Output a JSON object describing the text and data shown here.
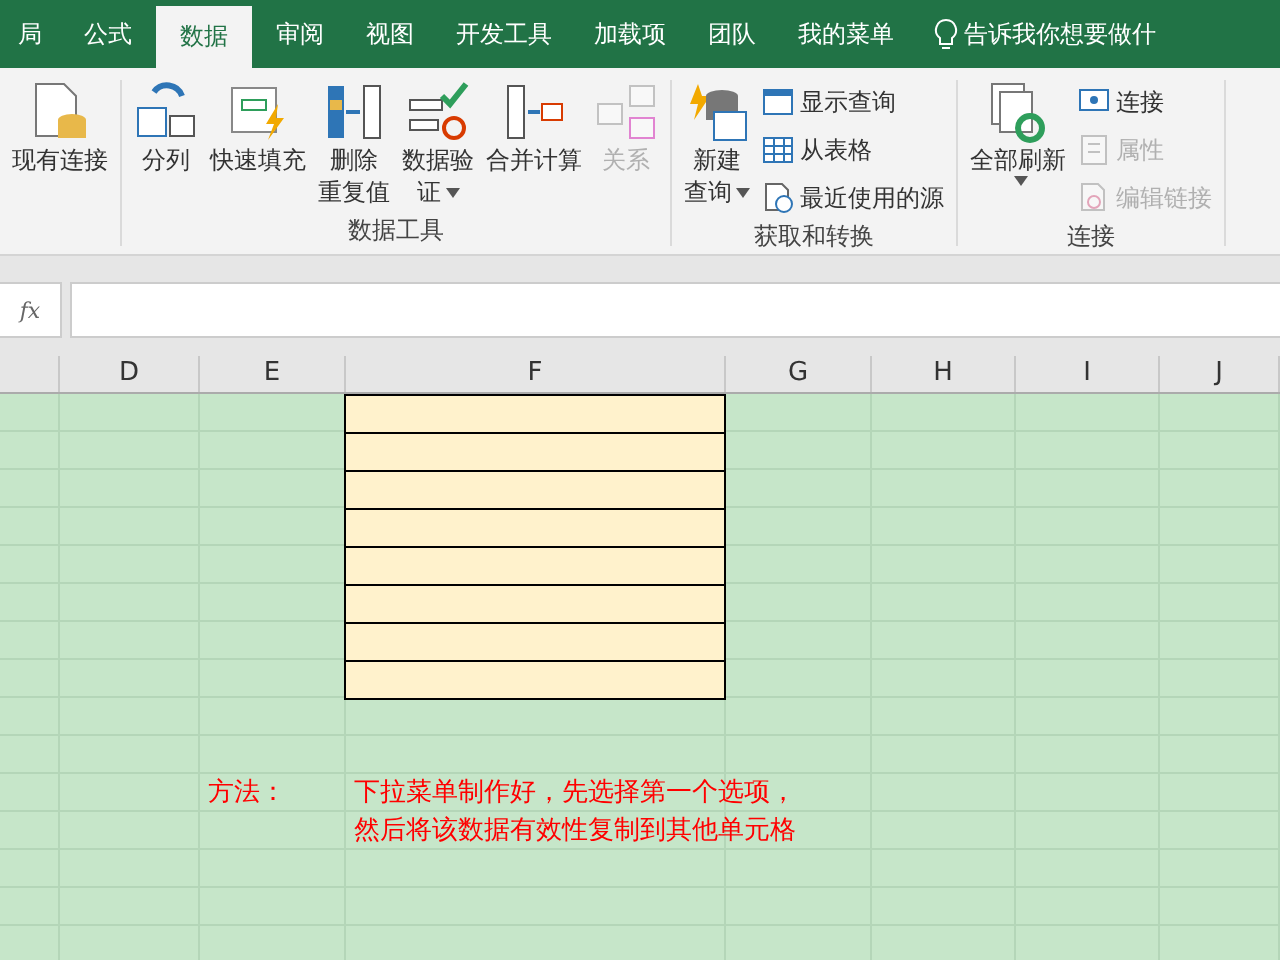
{
  "tabs": [
    {
      "label": "局",
      "selected": false
    },
    {
      "label": "公式",
      "selected": false
    },
    {
      "label": "数据",
      "selected": true
    },
    {
      "label": "审阅",
      "selected": false
    },
    {
      "label": "视图",
      "selected": false
    },
    {
      "label": "开发工具",
      "selected": false
    },
    {
      "label": "加载项",
      "selected": false
    },
    {
      "label": "团队",
      "selected": false
    },
    {
      "label": "我的菜单",
      "selected": false
    }
  ],
  "tell_me": "告诉我你想要做什",
  "ribbon_groups": [
    {
      "large": [
        {
          "lines": [
            "现有连接"
          ],
          "dropdown": false,
          "disabled": false
        }
      ]
    },
    {
      "label": "数据工具",
      "large": [
        {
          "lines": [
            "分列"
          ],
          "dropdown": false,
          "disabled": false
        },
        {
          "lines": [
            "快速填充"
          ],
          "dropdown": false,
          "disabled": false
        },
        {
          "lines": [
            "删除",
            "重复值"
          ],
          "dropdown": false,
          "disabled": false
        },
        {
          "lines": [
            "数据验",
            "证"
          ],
          "dropdown": true,
          "disabled": false
        },
        {
          "lines": [
            "合并计算"
          ],
          "dropdown": false,
          "disabled": false
        },
        {
          "lines": [
            "关系"
          ],
          "dropdown": false,
          "disabled": true
        }
      ]
    },
    {
      "label": "获取和转换",
      "large": [
        {
          "lines": [
            "新建",
            "查询"
          ],
          "dropdown": true,
          "disabled": false
        }
      ],
      "small": [
        {
          "label": "显示查询",
          "disabled": false
        },
        {
          "label": "从表格",
          "disabled": false
        },
        {
          "label": "最近使用的源",
          "disabled": false
        }
      ]
    },
    {
      "label": "连接",
      "large": [
        {
          "lines": [
            "全部刷新"
          ],
          "dropdown": true,
          "disabled": false
        }
      ],
      "small": [
        {
          "label": "连接",
          "disabled": false
        },
        {
          "label": "属性",
          "disabled": true
        },
        {
          "label": "编辑链接",
          "disabled": true
        }
      ]
    }
  ],
  "formula_bar": {
    "fx": "fx"
  },
  "columns": [
    "D",
    "E",
    "F",
    "G",
    "H",
    "I",
    "J"
  ],
  "note": {
    "label": "方法：",
    "lines": [
      "下拉菜单制作好，先选择第一个选项，",
      "然后将该数据有效性复制到其他单元格"
    ]
  }
}
